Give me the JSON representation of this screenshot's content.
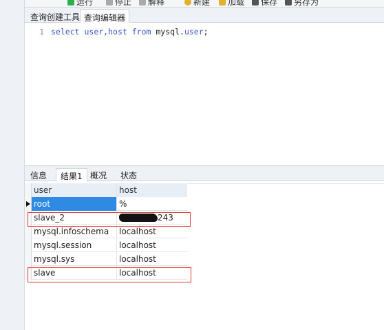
{
  "toolbar": {
    "items": [
      {
        "label": "运行",
        "icon": "run-icon",
        "color": "#2bb24c"
      },
      {
        "label": "停止",
        "icon": "stop-icon",
        "color": "#999999"
      },
      {
        "label": "解释",
        "icon": "explain-icon",
        "color": "#999999"
      },
      {
        "label": "新建",
        "icon": "new-icon",
        "color": "#e0b12a"
      },
      {
        "label": "加载",
        "icon": "load-icon",
        "color": "#e0b12a"
      },
      {
        "label": "保存",
        "icon": "save-icon",
        "color": "#555555"
      },
      {
        "label": "另存为",
        "icon": "save-as-icon",
        "color": "#555555"
      }
    ]
  },
  "editor_tabs": [
    "查询创建工具",
    "查询编辑器"
  ],
  "editor": {
    "line_number": "1",
    "tokens": {
      "select": "select",
      "cols": "user,host",
      "from": "from",
      "db": "mysql",
      "dot": ".",
      "table": "user",
      "end": ";"
    }
  },
  "result_tabs": [
    "信息",
    "结果1",
    "概况",
    "状态"
  ],
  "grid": {
    "columns": [
      "user",
      "host"
    ],
    "rows": [
      {
        "user": "root",
        "host": "%"
      },
      {
        "user": "slave_2",
        "host": "243"
      },
      {
        "user": "mysql.infoschema",
        "host": "localhost"
      },
      {
        "user": "mysql.session",
        "host": "localhost"
      },
      {
        "user": "mysql.sys",
        "host": "localhost"
      },
      {
        "user": "slave",
        "host": "localhost"
      }
    ]
  },
  "colors": {
    "selection": "#2f8ae4",
    "highlight_box": "#e23b3b",
    "keyword": "#3a55c9"
  }
}
